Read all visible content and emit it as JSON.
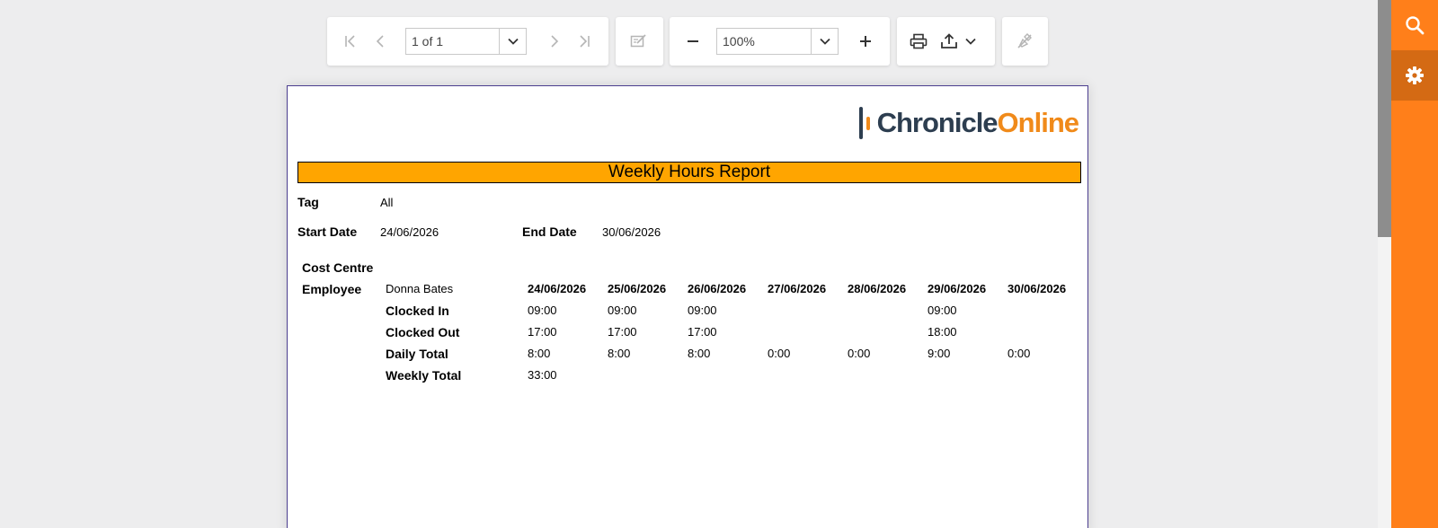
{
  "toolbar": {
    "page_indicator": "1 of 1",
    "zoom_value": "100%"
  },
  "report": {
    "logo": {
      "part1": "Chronicle",
      "part2": "Online"
    },
    "title": "Weekly Hours Report",
    "filters": {
      "tag_label": "Tag",
      "tag_value": "All",
      "start_label": "Start Date",
      "start_value": "24/06/2026",
      "end_label": "End Date",
      "end_value": "30/06/2026"
    },
    "cost_centre_label": "Cost Centre",
    "employee_label": "Employee",
    "employee_name": "Donna Bates",
    "dates": [
      "24/06/2026",
      "25/06/2026",
      "26/06/2026",
      "27/06/2026",
      "28/06/2026",
      "29/06/2026",
      "30/06/2026"
    ],
    "rows": [
      {
        "label": "Clocked In",
        "values": [
          "09:00",
          "09:00",
          "09:00",
          "",
          "",
          "09:00",
          ""
        ]
      },
      {
        "label": "Clocked Out",
        "values": [
          "17:00",
          "17:00",
          "17:00",
          "",
          "",
          "18:00",
          ""
        ]
      },
      {
        "label": "Daily Total",
        "values": [
          "8:00",
          "8:00",
          "8:00",
          "0:00",
          "0:00",
          "9:00",
          "0:00"
        ]
      }
    ],
    "weekly_total_label": "Weekly Total",
    "weekly_total_value": "33:00"
  },
  "colors": {
    "accent": "#ff7f1a",
    "title_fill": "#ffa500",
    "logo_dark": "#2d3e50",
    "logo_orange": "#f08a1a"
  },
  "icons": {
    "first_page": "first-page-icon",
    "prev_page": "prev-page-icon",
    "next_page": "next-page-icon",
    "last_page": "last-page-icon",
    "editing": "edit-form-icon",
    "zoom_out": "minus-icon",
    "zoom_in": "plus-icon",
    "print": "print-icon",
    "export": "export-icon",
    "highlight": "highlight-off-icon",
    "search": "search-icon",
    "parameters": "gear-icon"
  }
}
